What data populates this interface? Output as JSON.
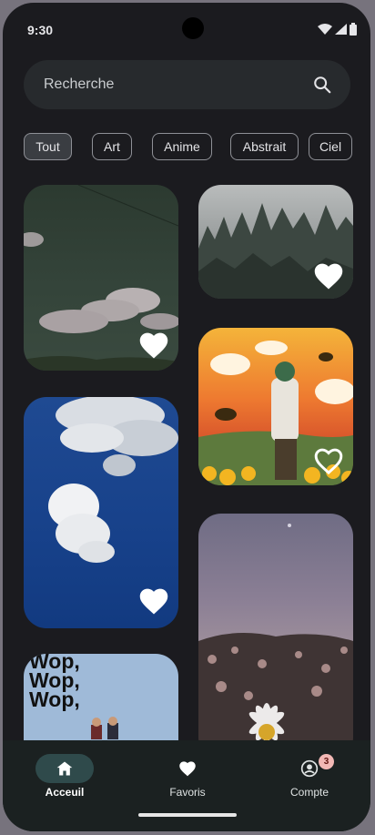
{
  "status_bar": {
    "time": "9:30"
  },
  "search": {
    "placeholder": "Recherche"
  },
  "filters": {
    "chips": [
      {
        "label": "Tout",
        "selected": true
      },
      {
        "label": "Art",
        "selected": false
      },
      {
        "label": "Anime",
        "selected": false
      },
      {
        "label": "Abstrait",
        "selected": false
      },
      {
        "label": "Ciel",
        "selected": false
      }
    ]
  },
  "wallpapers": [
    {
      "subject": "clouds over dark green sky",
      "favorited": true
    },
    {
      "subject": "misty pine forest",
      "favorited": true
    },
    {
      "subject": "bees over sunflower field with person",
      "favorited": false
    },
    {
      "subject": "white clouds on blue sky",
      "favorited": true
    },
    {
      "subject": "daisies under purple sky",
      "favorited": false
    },
    {
      "subject": "Wop poster",
      "favorited": false,
      "text": "Wop,\nWop,\nWop,"
    }
  ],
  "bottom_nav": {
    "items": [
      {
        "label": "Acceuil",
        "icon": "home-icon",
        "active": true
      },
      {
        "label": "Favoris",
        "icon": "heart-icon",
        "active": false
      },
      {
        "label": "Compte",
        "icon": "account-icon",
        "active": false,
        "badge": "3"
      }
    ]
  },
  "colors": {
    "background": "#1b1b1f",
    "accent": "#2f4a4b",
    "badge": "#f2b8b5"
  }
}
